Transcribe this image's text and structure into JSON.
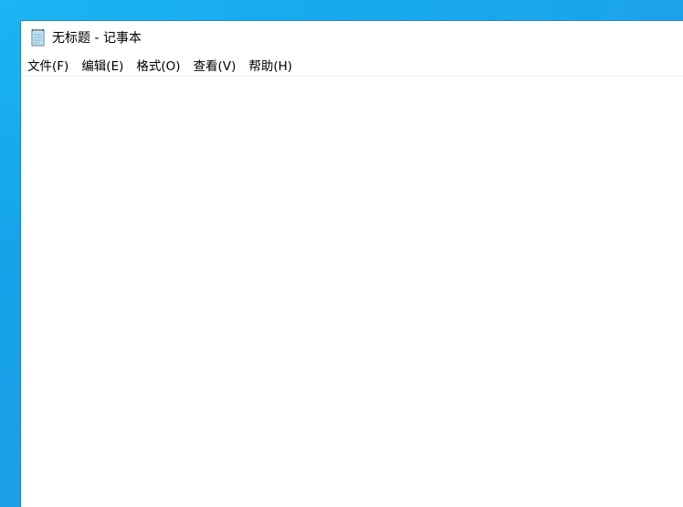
{
  "window": {
    "title": "无标题 - 记事本",
    "app_icon": "notepad-icon"
  },
  "menu": {
    "items": [
      {
        "label": "文件(F)"
      },
      {
        "label": "编辑(E)"
      },
      {
        "label": "格式(O)"
      },
      {
        "label": "查看(V)"
      },
      {
        "label": "帮助(H)"
      }
    ]
  },
  "editor": {
    "value": ""
  },
  "colors": {
    "desktop": "#1aa8ec",
    "window_bg": "#ffffff",
    "window_border": "#1d86c7"
  }
}
